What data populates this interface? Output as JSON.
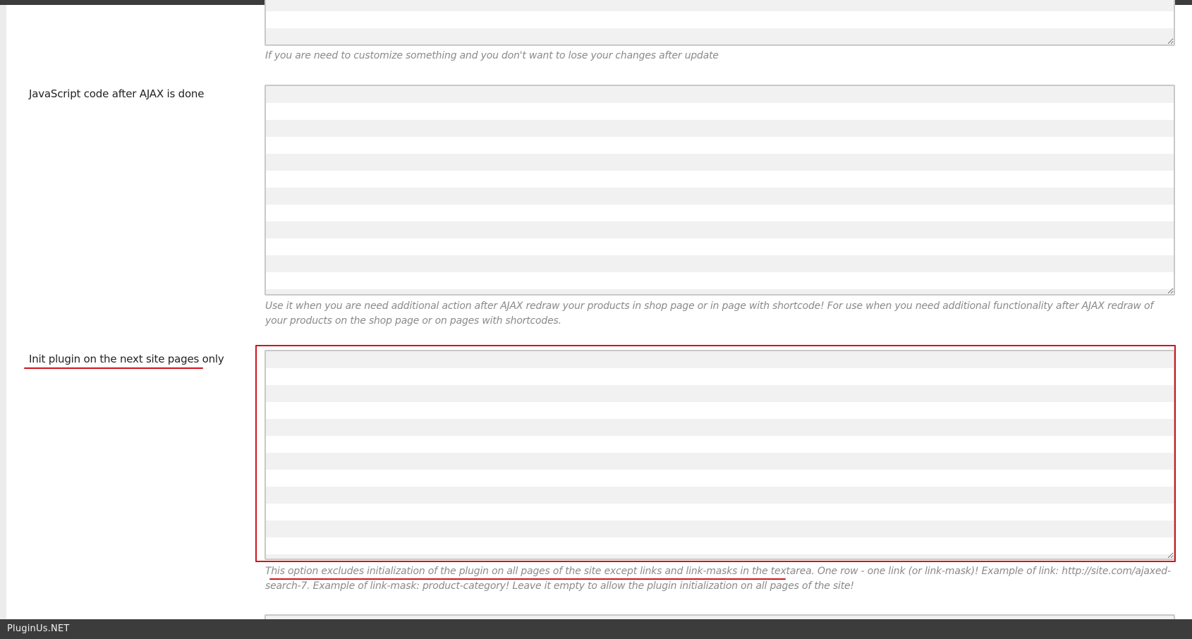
{
  "settings": [
    {
      "label": "",
      "value": "",
      "description": "If you are need to customize something and you don't want to lose your changes after update"
    },
    {
      "label": "JavaScript code after AJAX is done",
      "value": "",
      "description": "Use it when you are need additional action after AJAX redraw your products in shop page or in page with shortcode! For use when you need additional functionality after AJAX redraw of your products on the shop page or on pages with shortcodes."
    },
    {
      "label": "Init plugin on the next site pages only",
      "value": "",
      "description": "This option excludes initialization of the plugin on all pages of the site except links and link-masks in the textarea. One row - one link (or link-mask)! Example of link: http://site.com/ajaxed-search-7. Example of link-mask: product-category! Leave it empty to allow the plugin initialization on all pages of the site!"
    }
  ],
  "footer": {
    "brand": "PluginUs.NET"
  },
  "colors": {
    "highlight": "#d0141c",
    "description_text": "#8a8a8a",
    "footer_bg": "#3c3c3c"
  }
}
